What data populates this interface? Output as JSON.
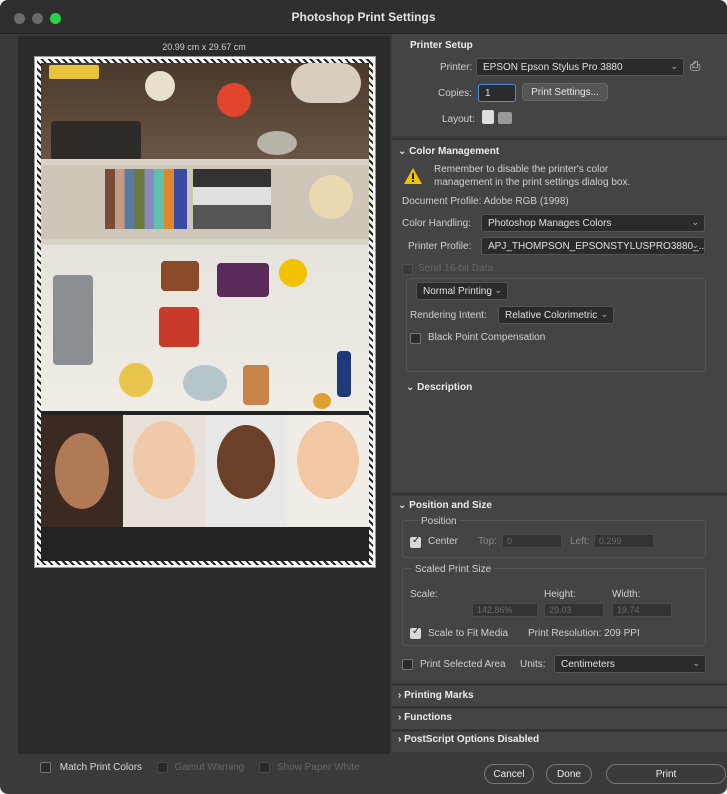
{
  "window": {
    "title": "Photoshop Print Settings"
  },
  "preview": {
    "paper_size": "20.99 cm x 29.67 cm"
  },
  "bottom_options": {
    "match_print_colors": "Match Print Colors",
    "gamut_warning": "Gamut Warning",
    "show_paper_white": "Show Paper White"
  },
  "printer_setup": {
    "heading": "Printer Setup",
    "printer_label": "Printer:",
    "printer_value": "EPSON Epson Stylus Pro 3880",
    "copies_label": "Copies:",
    "copies_value": "1",
    "print_settings_button": "Print Settings...",
    "layout_label": "Layout:"
  },
  "color_management": {
    "heading": "Color Management",
    "warning_line1": "Remember to disable the printer's color",
    "warning_line2": "management in the print settings dialog box.",
    "document_profile": "Document Profile: Adobe RGB (1998)",
    "color_handling_label": "Color Handling:",
    "color_handling_value": "Photoshop Manages Colors",
    "printer_profile_label": "Printer Profile:",
    "printer_profile_value": "APJ_THOMPSON_EPSONSTYLUSPRO3880_...",
    "send_16bit": "Send 16-bit Data",
    "normal_printing": "Normal Printing",
    "rendering_intent_label": "Rendering Intent:",
    "rendering_intent_value": "Relative Colorimetric",
    "black_point": "Black Point Compensation"
  },
  "description": {
    "heading": "Description"
  },
  "position_size": {
    "heading": "Position and Size",
    "position_label": "Position",
    "center": "Center",
    "top_label": "Top:",
    "top_value": "0",
    "left_label": "Left:",
    "left_value": "0.299",
    "scaled_print_size": "Scaled Print Size",
    "scale_label": "Scale:",
    "height_label": "Height:",
    "width_label": "Width:",
    "scale_value": "142.86%",
    "height_value": "29.03",
    "width_value": "19.74",
    "scale_to_fit": "Scale to Fit Media",
    "print_resolution": "Print Resolution: 209 PPI",
    "print_selected_area": "Print Selected Area",
    "units_label": "Units:",
    "units_value": "Centimeters"
  },
  "collapsed_sections": {
    "printing_marks": "Printing Marks",
    "functions": "Functions",
    "postscript": "PostScript Options Disabled"
  },
  "footer": {
    "cancel": "Cancel",
    "done": "Done",
    "print": "Print"
  }
}
